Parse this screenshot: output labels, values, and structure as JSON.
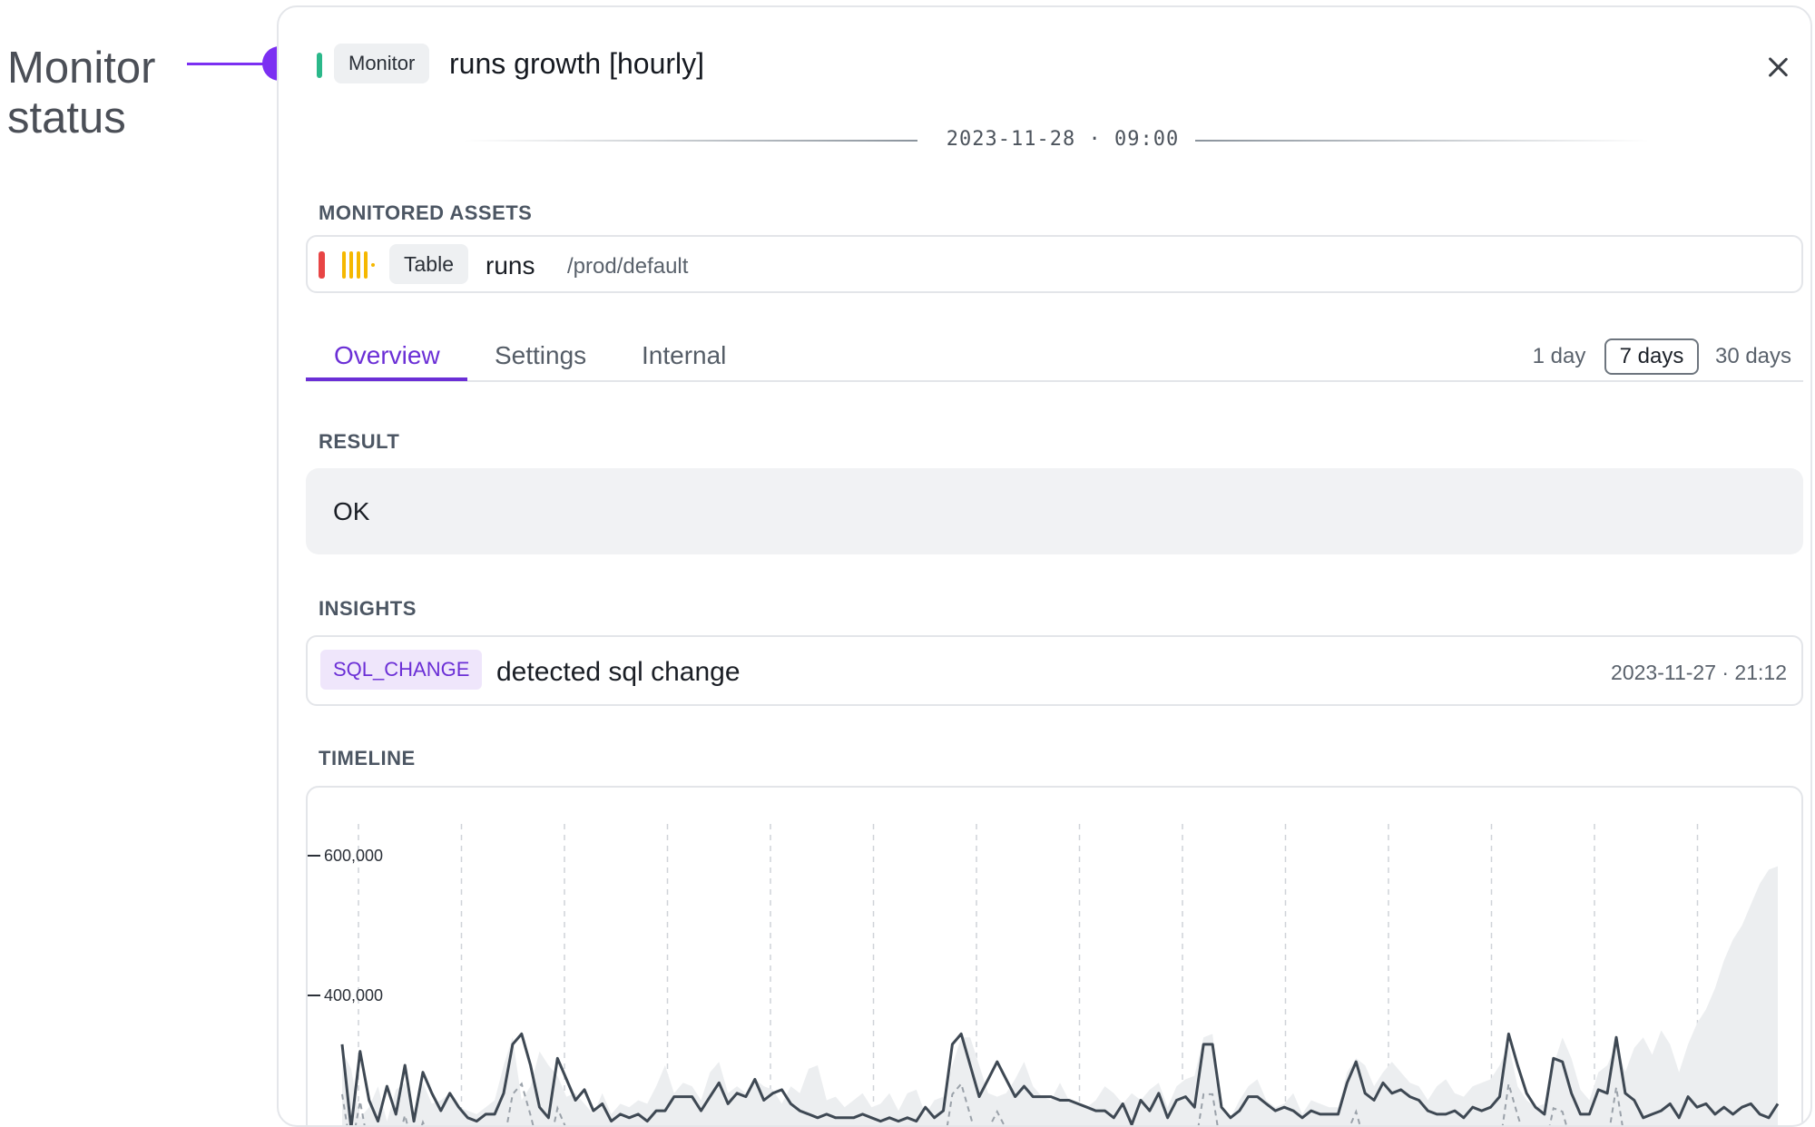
{
  "callout": {
    "label_line1": "Monitor",
    "label_line2": "status"
  },
  "header": {
    "status_color": "#2bb88a",
    "badge": "Monitor",
    "title": "runs growth [hourly]",
    "close_icon": "close-icon"
  },
  "timestamp": "2023-11-28 · 09:00",
  "monitored_assets": {
    "label": "MONITORED ASSETS",
    "asset": {
      "type": "Table",
      "name": "runs",
      "path": "/prod/default",
      "status_color": "#e84545",
      "icon": "table-bars-icon"
    }
  },
  "tabs": [
    {
      "label": "Overview",
      "active": true
    },
    {
      "label": "Settings",
      "active": false
    },
    {
      "label": "Internal",
      "active": false
    }
  ],
  "ranges": [
    {
      "label": "1 day",
      "selected": false
    },
    {
      "label": "7 days",
      "selected": true
    },
    {
      "label": "30 days",
      "selected": false
    }
  ],
  "result": {
    "label": "RESULT",
    "value": "OK"
  },
  "insights": {
    "label": "INSIGHTS",
    "items": [
      {
        "tag": "SQL_CHANGE",
        "text": "detected sql change",
        "time": "2023-11-27 · 21:12"
      }
    ]
  },
  "timeline": {
    "label": "TIMELINE"
  },
  "chart_data": {
    "type": "line",
    "y_ticks": [
      {
        "value": 600000,
        "label": "600,000"
      },
      {
        "value": 400000,
        "label": "400,000"
      }
    ],
    "series": [
      {
        "values": [
          320000,
          295000,
          225000,
          240000,
          270000,
          220000,
          265000,
          275000,
          230000,
          275000,
          245000,
          250000,
          260000,
          240000,
          235000,
          230000,
          240000,
          250000,
          300000,
          340000,
          250000,
          270000,
          320000,
          300000,
          285000,
          255000,
          260000,
          245000,
          230000,
          260000,
          230000,
          245000,
          240000,
          250000,
          245000,
          270000,
          300000,
          260000,
          275000,
          270000,
          250000,
          290000,
          305000,
          260000,
          270000,
          260000,
          280000,
          270000,
          265000,
          245000,
          270000,
          260000,
          295000,
          300000,
          250000,
          255000,
          240000,
          250000,
          260000,
          240000,
          245000,
          260000,
          235000,
          260000,
          265000,
          230000,
          250000,
          255000,
          300000,
          340000,
          340000,
          300000,
          260000,
          255000,
          260000,
          280000,
          305000,
          270000,
          255000,
          250000,
          275000,
          250000,
          245000,
          240000,
          250000,
          270000,
          260000,
          245000,
          260000,
          250000,
          265000,
          275000,
          240000,
          270000,
          280000,
          285000,
          340000,
          345000,
          240000,
          225000,
          250000,
          270000,
          280000,
          250000,
          240000,
          245000,
          260000,
          230000,
          250000,
          245000,
          240000,
          240000,
          290000,
          310000,
          300000,
          270000,
          290000,
          305000,
          290000,
          275000,
          270000,
          250000,
          270000,
          280000,
          260000,
          255000,
          270000,
          275000,
          280000,
          300000,
          330000,
          270000,
          250000,
          240000,
          245000,
          300000,
          340000,
          310000,
          265000,
          250000,
          290000,
          300000,
          330000,
          290000,
          325000,
          340000,
          315000,
          350000,
          330000,
          290000,
          330000,
          360000,
          380000,
          410000,
          450000,
          480000,
          500000,
          530000,
          560000,
          580000,
          585000
        ]
      },
      {
        "values": [
          330000,
          210000,
          320000,
          250000,
          220000,
          270000,
          230000,
          300000,
          220000,
          290000,
          260000,
          235000,
          260000,
          240000,
          225000,
          220000,
          230000,
          230000,
          260000,
          330000,
          345000,
          300000,
          240000,
          225000,
          310000,
          280000,
          250000,
          265000,
          235000,
          245000,
          220000,
          230000,
          225000,
          230000,
          220000,
          235000,
          235000,
          255000,
          255000,
          255000,
          235000,
          255000,
          275000,
          245000,
          260000,
          255000,
          280000,
          250000,
          260000,
          265000,
          245000,
          235000,
          230000,
          225000,
          230000,
          225000,
          225000,
          225000,
          230000,
          225000,
          220000,
          225000,
          220000,
          225000,
          220000,
          240000,
          225000,
          235000,
          330000,
          345000,
          300000,
          255000,
          280000,
          305000,
          280000,
          255000,
          270000,
          255000,
          255000,
          255000,
          250000,
          250000,
          245000,
          240000,
          235000,
          235000,
          225000,
          245000,
          215000,
          250000,
          235000,
          260000,
          225000,
          250000,
          255000,
          240000,
          330000,
          330000,
          240000,
          225000,
          235000,
          255000,
          255000,
          245000,
          235000,
          240000,
          235000,
          225000,
          235000,
          230000,
          230000,
          230000,
          275000,
          305000,
          260000,
          250000,
          275000,
          260000,
          265000,
          255000,
          250000,
          235000,
          230000,
          230000,
          235000,
          225000,
          240000,
          235000,
          240000,
          255000,
          345000,
          300000,
          260000,
          240000,
          230000,
          310000,
          305000,
          260000,
          230000,
          230000,
          265000,
          260000,
          340000,
          260000,
          250000,
          225000,
          230000,
          235000,
          245000,
          225000,
          255000,
          240000,
          245000,
          230000,
          240000,
          230000,
          240000,
          245000,
          230000,
          225000,
          245000
        ]
      }
    ]
  }
}
